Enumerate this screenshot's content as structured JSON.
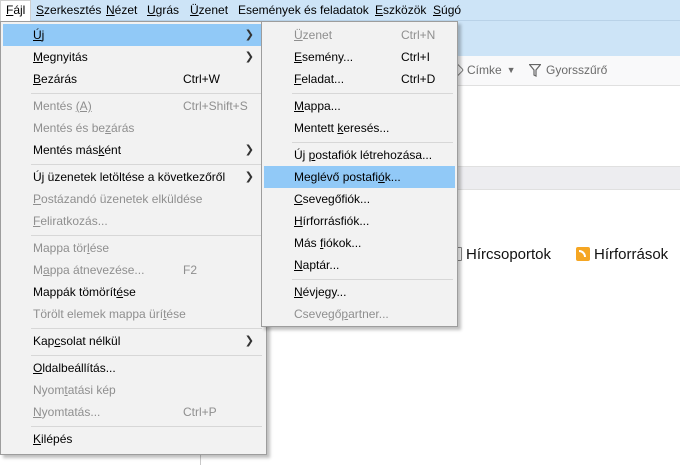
{
  "menubar": {
    "items": [
      {
        "pre": "",
        "u": "F",
        "post": "ájl"
      },
      {
        "pre": "",
        "u": "S",
        "post": "zerkesztés"
      },
      {
        "pre": "",
        "u": "N",
        "post": "ézet"
      },
      {
        "pre": "",
        "u": "U",
        "post": "grás"
      },
      {
        "pre": "",
        "u": "Ü",
        "post": "zenet"
      },
      {
        "pre": "Események és feladatok",
        "u": "",
        "post": ""
      },
      {
        "pre": "",
        "u": "E",
        "post": "szközök"
      },
      {
        "pre": "",
        "u": "S",
        "post": "úgó"
      }
    ]
  },
  "toolbar": {
    "tag_label": "Címke",
    "quickfilter_label": "Gyorsszűrő"
  },
  "content": {
    "newsgroups_label": "Hírcsoportok",
    "feeds_label": "Hírforrások"
  },
  "file_menu": {
    "items": [
      {
        "pre": "",
        "u": "Ú",
        "post": "j",
        "shortcut": "",
        "submenu": true,
        "disabled": false,
        "highlight": true
      },
      {
        "pre": "",
        "u": "M",
        "post": "egnyitás",
        "shortcut": "",
        "submenu": true,
        "disabled": false
      },
      {
        "pre": "",
        "u": "B",
        "post": "ezárás",
        "shortcut": "Ctrl+W",
        "submenu": false,
        "disabled": false
      },
      {
        "pre": "Mentés ",
        "u": "(A)",
        "post": "",
        "shortcut": "Ctrl+Shift+S",
        "submenu": false,
        "disabled": true
      },
      {
        "pre": "Mentés és be",
        "u": "z",
        "post": "árás",
        "shortcut": "",
        "submenu": false,
        "disabled": true
      },
      {
        "pre": "Mentés más",
        "u": "k",
        "post": "ént",
        "shortcut": "",
        "submenu": true,
        "disabled": false
      },
      {
        "pre": "Ú",
        "u": "j",
        "post": " üzenetek letöltése a következőről",
        "shortcut": "",
        "submenu": true,
        "disabled": false
      },
      {
        "pre": "",
        "u": "P",
        "post": "ostázandó üzenetek elküldése",
        "shortcut": "",
        "submenu": false,
        "disabled": true
      },
      {
        "pre": "",
        "u": "F",
        "post": "eliratkozás...",
        "shortcut": "",
        "submenu": false,
        "disabled": true
      },
      {
        "pre": "Mappa tör",
        "u": "l",
        "post": "ése",
        "shortcut": "",
        "submenu": false,
        "disabled": true
      },
      {
        "pre": "M",
        "u": "a",
        "post": "ppa átnevezése...",
        "shortcut": "F2",
        "submenu": false,
        "disabled": true
      },
      {
        "pre": "Mappák tömörít",
        "u": "é",
        "post": "se",
        "shortcut": "",
        "submenu": false,
        "disabled": false
      },
      {
        "pre": "Törölt elemek mappa ürí",
        "u": "t",
        "post": "ése",
        "shortcut": "",
        "submenu": false,
        "disabled": true
      },
      {
        "pre": "Kap",
        "u": "c",
        "post": "solat nélkül",
        "shortcut": "",
        "submenu": true,
        "disabled": false
      },
      {
        "pre": "",
        "u": "O",
        "post": "ldalbeállítás...",
        "shortcut": "",
        "submenu": false,
        "disabled": false
      },
      {
        "pre": "Nyom",
        "u": "t",
        "post": "atási kép",
        "shortcut": "",
        "submenu": false,
        "disabled": true
      },
      {
        "pre": "",
        "u": "N",
        "post": "yomtatás...",
        "shortcut": "Ctrl+P",
        "submenu": false,
        "disabled": true
      },
      {
        "pre": "",
        "u": "K",
        "post": "ilépés",
        "shortcut": "",
        "submenu": false,
        "disabled": false
      }
    ]
  },
  "new_submenu": {
    "items": [
      {
        "pre": "",
        "u": "Ü",
        "post": "zenet",
        "shortcut": "Ctrl+N",
        "disabled": true
      },
      {
        "pre": "",
        "u": "E",
        "post": "semény...",
        "shortcut": "Ctrl+I",
        "disabled": false
      },
      {
        "pre": "",
        "u": "F",
        "post": "eladat...",
        "shortcut": "Ctrl+D",
        "disabled": false
      },
      {
        "pre": "",
        "u": "M",
        "post": "appa...",
        "shortcut": "",
        "disabled": false
      },
      {
        "pre": "Mentett ",
        "u": "k",
        "post": "eresés...",
        "shortcut": "",
        "disabled": false
      },
      {
        "pre": "Új ",
        "u": "p",
        "post": "ostafiók létrehozása...",
        "shortcut": "",
        "disabled": false
      },
      {
        "pre": "Meglévő postafi",
        "u": "ó",
        "post": "k...",
        "shortcut": "",
        "disabled": false,
        "highlight": true
      },
      {
        "pre": "",
        "u": "C",
        "post": "sevegőfiók...",
        "shortcut": "",
        "disabled": false
      },
      {
        "pre": "",
        "u": "H",
        "post": "írforrásfiók...",
        "shortcut": "",
        "disabled": false
      },
      {
        "pre": "Más ",
        "u": "f",
        "post": "iókok...",
        "shortcut": "",
        "disabled": false
      },
      {
        "pre": "",
        "u": "N",
        "post": "aptár...",
        "shortcut": "",
        "disabled": false
      },
      {
        "pre": "",
        "u": "N",
        "post": "évjegy...",
        "shortcut": "",
        "disabled": false
      },
      {
        "pre": "Csevegő",
        "u": "p",
        "post": "artner...",
        "shortcut": "",
        "disabled": true
      }
    ]
  }
}
